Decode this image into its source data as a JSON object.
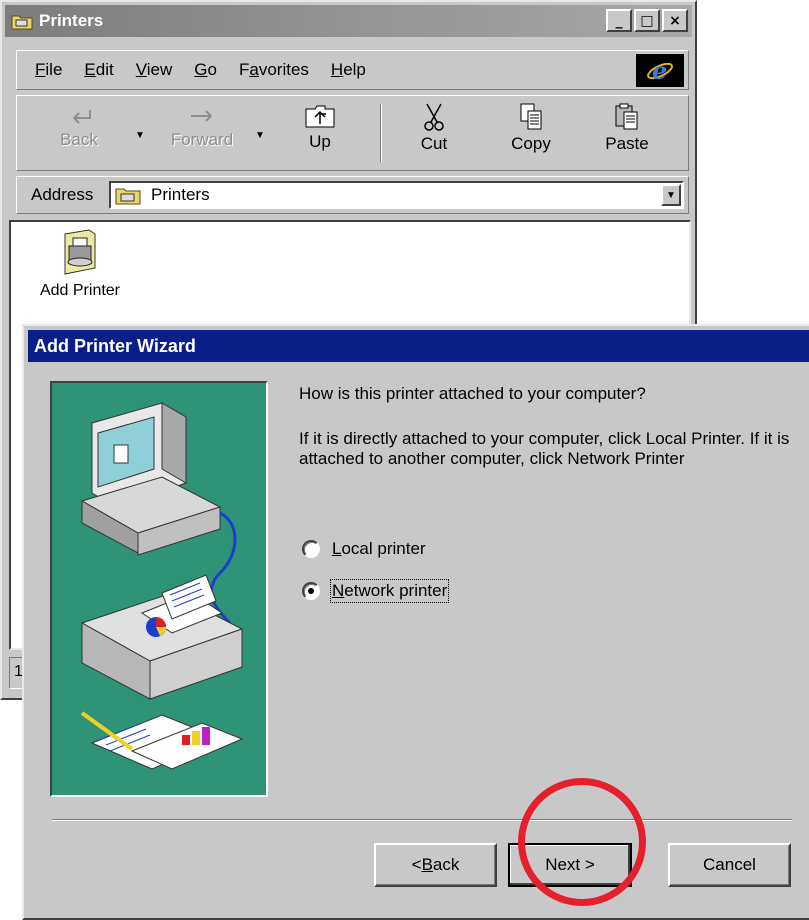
{
  "explorer": {
    "title": "Printers",
    "window_buttons": {
      "minimize": "_",
      "maximize": "□",
      "close": "×"
    },
    "menu": [
      {
        "pre": "",
        "key": "F",
        "post": "ile"
      },
      {
        "pre": "",
        "key": "E",
        "post": "dit"
      },
      {
        "pre": "",
        "key": "V",
        "post": "iew"
      },
      {
        "pre": "",
        "key": "G",
        "post": "o"
      },
      {
        "pre": "F",
        "key": "a",
        "post": "vorites"
      },
      {
        "pre": "",
        "key": "H",
        "post": "elp"
      }
    ],
    "toolbar": {
      "back": "Back",
      "forward": "Forward",
      "up": "Up",
      "cut": "Cut",
      "copy": "Copy",
      "paste": "Paste"
    },
    "address": {
      "label": "Address",
      "value": "Printers"
    },
    "items": [
      {
        "label": "Add Printer",
        "icon": "add-printer-icon"
      }
    ],
    "status_text": "1"
  },
  "wizard": {
    "title": "Add Printer Wizard",
    "question": "How is this printer attached to your computer?",
    "explanation": "If it is directly attached to your computer, click Local Printer. If it is attached to another computer, click Network Printer",
    "options": [
      {
        "pre": "",
        "key": "L",
        "post": "ocal printer",
        "selected": false
      },
      {
        "pre": "",
        "key": "N",
        "post": "etwork printer",
        "selected": true
      }
    ],
    "buttons": {
      "back": {
        "pre": "< ",
        "key": "B",
        "post": "ack"
      },
      "next": "Next >",
      "cancel": "Cancel"
    }
  },
  "colors": {
    "wizard_title_bg": "#0a1e88",
    "wizard_art_bg": "#2e9377",
    "highlight_circle": "#e4202c",
    "window_face": "#c8c8c8"
  }
}
